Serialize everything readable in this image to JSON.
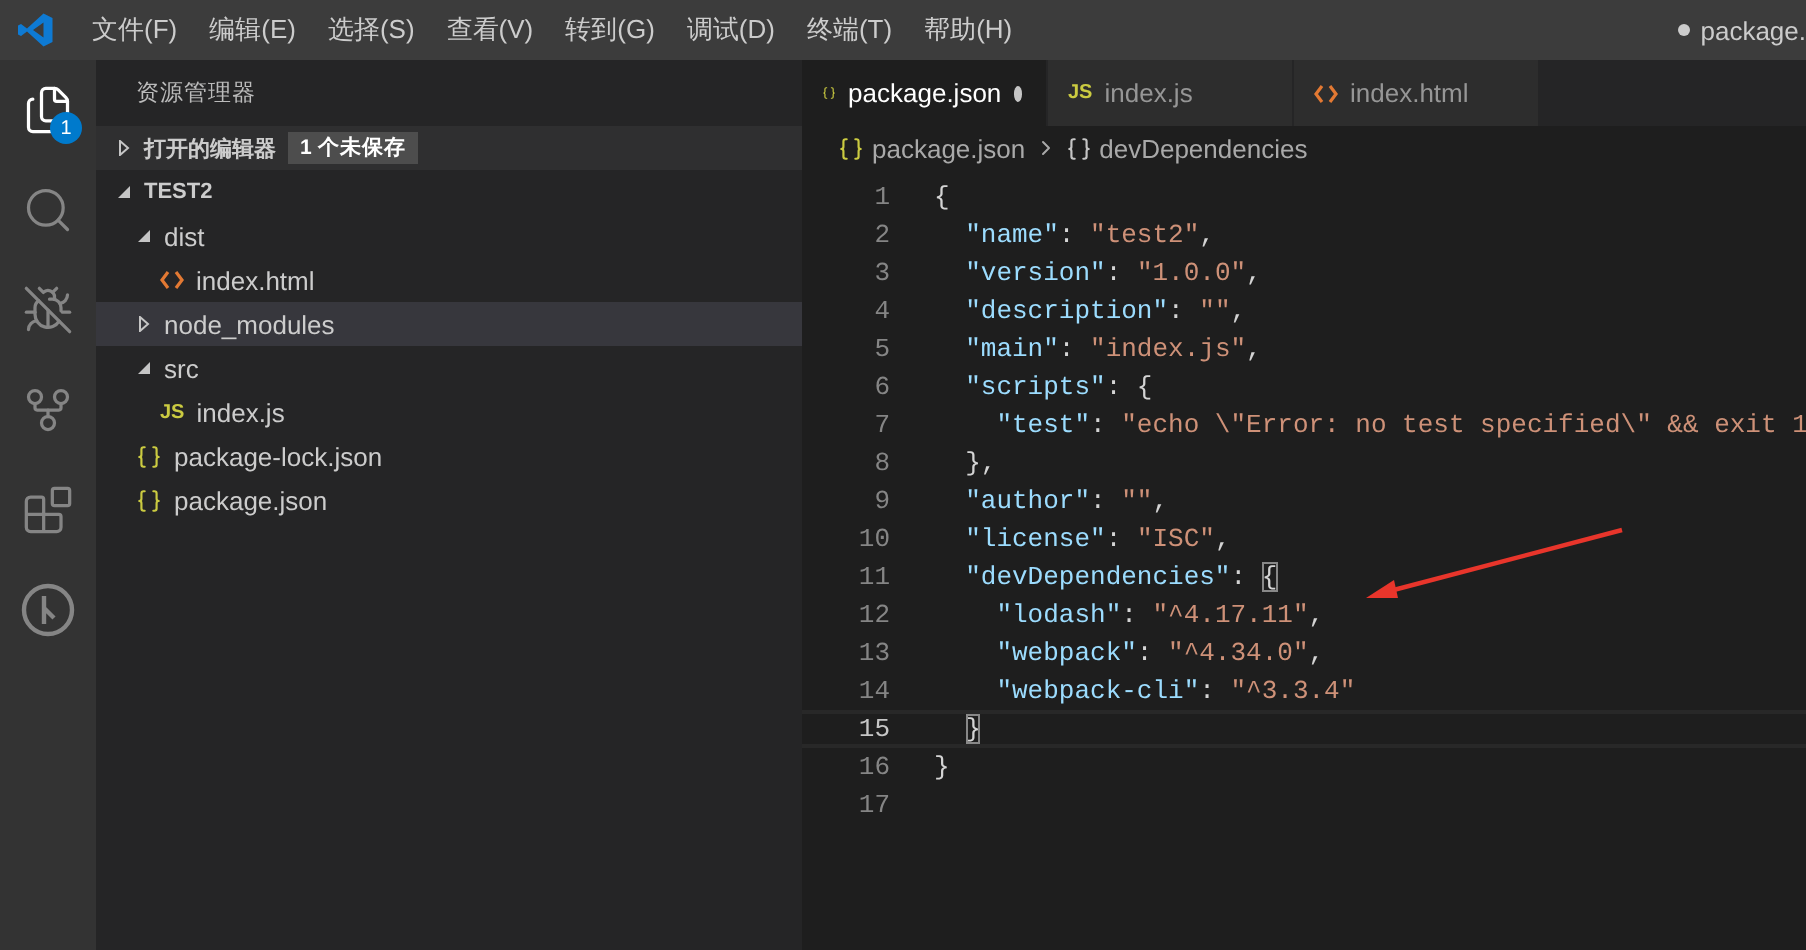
{
  "title_bar": {
    "menus": [
      "文件(F)",
      "编辑(E)",
      "选择(S)",
      "查看(V)",
      "转到(G)",
      "调试(D)",
      "终端(T)",
      "帮助(H)"
    ],
    "title": "package.",
    "dirty": true
  },
  "activity_bar": [
    {
      "kind": "files",
      "selected": true,
      "badge": "1"
    },
    {
      "kind": "search",
      "selected": false
    },
    {
      "kind": "debug",
      "selected": false
    },
    {
      "kind": "git",
      "selected": false
    },
    {
      "kind": "extensions",
      "selected": false
    },
    {
      "kind": "remote",
      "selected": false
    }
  ],
  "sidebar": {
    "title": "资源管理器",
    "open_editors": {
      "label": "打开的编辑器",
      "badge": "1 个未保存",
      "expanded": false
    },
    "folder": {
      "label": "TEST2",
      "expanded": true,
      "items": [
        {
          "label": "dist",
          "kind": "folder",
          "expanded": true,
          "selected": false,
          "children": [
            {
              "label": "index.html",
              "kind": "html",
              "selected": false
            }
          ]
        },
        {
          "label": "node_modules",
          "kind": "folder",
          "expanded": false,
          "selected": true
        },
        {
          "label": "src",
          "kind": "folder",
          "expanded": true,
          "selected": false,
          "children": [
            {
              "label": "index.js",
              "kind": "js",
              "glyph": "JS",
              "selected": false
            }
          ]
        },
        {
          "label": "package-lock.json",
          "kind": "json",
          "selected": false
        },
        {
          "label": "package.json",
          "kind": "json",
          "selected": false
        }
      ]
    }
  },
  "tabs": [
    {
      "label": "package.json",
      "kind": "json",
      "selected": true,
      "dirty": true
    },
    {
      "label": "index.js",
      "kind": "js",
      "glyph": "JS",
      "selected": false,
      "dirty": false
    },
    {
      "label": "index.html",
      "kind": "html",
      "selected": false,
      "dirty": false
    }
  ],
  "breadcrumb": [
    {
      "label": "package.json",
      "kind": "json"
    },
    {
      "label": "devDependencies",
      "kind": "object"
    }
  ],
  "code_lines": [
    {
      "number": "1",
      "current": false,
      "tokens": [
        {
          "kind": "punct",
          "text": "{"
        }
      ]
    },
    {
      "number": "2",
      "current": false,
      "tokens": [
        {
          "kind": "key",
          "text": "  \"name\""
        },
        {
          "kind": "punct",
          "text": ": "
        },
        {
          "kind": "string",
          "text": "\"test2\""
        },
        {
          "kind": "punct",
          "text": ","
        }
      ]
    },
    {
      "number": "3",
      "current": false,
      "tokens": [
        {
          "kind": "key",
          "text": "  \"version\""
        },
        {
          "kind": "punct",
          "text": ": "
        },
        {
          "kind": "string",
          "text": "\"1.0.0\""
        },
        {
          "kind": "punct",
          "text": ","
        }
      ]
    },
    {
      "number": "4",
      "current": false,
      "tokens": [
        {
          "kind": "key",
          "text": "  \"description\""
        },
        {
          "kind": "punct",
          "text": ": "
        },
        {
          "kind": "string",
          "text": "\"\""
        },
        {
          "kind": "punct",
          "text": ","
        }
      ]
    },
    {
      "number": "5",
      "current": false,
      "tokens": [
        {
          "kind": "key",
          "text": "  \"main\""
        },
        {
          "kind": "punct",
          "text": ": "
        },
        {
          "kind": "string",
          "text": "\"index.js\""
        },
        {
          "kind": "punct",
          "text": ","
        }
      ]
    },
    {
      "number": "6",
      "current": false,
      "tokens": [
        {
          "kind": "key",
          "text": "  \"scripts\""
        },
        {
          "kind": "punct",
          "text": ": {"
        }
      ]
    },
    {
      "number": "7",
      "current": false,
      "tokens": [
        {
          "kind": "key",
          "text": "    \"test\""
        },
        {
          "kind": "punct",
          "text": ": "
        },
        {
          "kind": "string",
          "text": "\"echo \\\"Error: no test specified\\\" && exit 1"
        }
      ]
    },
    {
      "number": "8",
      "current": false,
      "tokens": [
        {
          "kind": "punct",
          "text": "  },"
        }
      ]
    },
    {
      "number": "9",
      "current": false,
      "tokens": [
        {
          "kind": "key",
          "text": "  \"author\""
        },
        {
          "kind": "punct",
          "text": ": "
        },
        {
          "kind": "string",
          "text": "\"\""
        },
        {
          "kind": "punct",
          "text": ","
        }
      ]
    },
    {
      "number": "10",
      "current": false,
      "tokens": [
        {
          "kind": "key",
          "text": "  \"license\""
        },
        {
          "kind": "punct",
          "text": ": "
        },
        {
          "kind": "string",
          "text": "\"ISC\""
        },
        {
          "kind": "punct",
          "text": ","
        }
      ]
    },
    {
      "number": "11",
      "current": false,
      "tokens": [
        {
          "kind": "key",
          "text": "  \"devDependencies\""
        },
        {
          "kind": "punct",
          "text": ": "
        },
        {
          "kind": "bracket",
          "text": "{"
        }
      ]
    },
    {
      "number": "12",
      "current": false,
      "tokens": [
        {
          "kind": "key",
          "text": "    \"lodash\""
        },
        {
          "kind": "punct",
          "text": ": "
        },
        {
          "kind": "string",
          "text": "\"^4.17.11\""
        },
        {
          "kind": "punct",
          "text": ","
        }
      ]
    },
    {
      "number": "13",
      "current": false,
      "tokens": [
        {
          "kind": "key",
          "text": "    \"webpack\""
        },
        {
          "kind": "punct",
          "text": ": "
        },
        {
          "kind": "string",
          "text": "\"^4.34.0\""
        },
        {
          "kind": "punct",
          "text": ","
        }
      ]
    },
    {
      "number": "14",
      "current": false,
      "tokens": [
        {
          "kind": "key",
          "text": "    \"webpack-cli\""
        },
        {
          "kind": "punct",
          "text": ": "
        },
        {
          "kind": "string",
          "text": "\"^3.3.4\""
        }
      ]
    },
    {
      "number": "15",
      "current": true,
      "tokens": [
        {
          "kind": "bracket",
          "text": "  }"
        }
      ]
    },
    {
      "number": "16",
      "current": false,
      "tokens": [
        {
          "kind": "punct",
          "text": "}"
        }
      ]
    },
    {
      "number": "17",
      "current": false
    }
  ]
}
